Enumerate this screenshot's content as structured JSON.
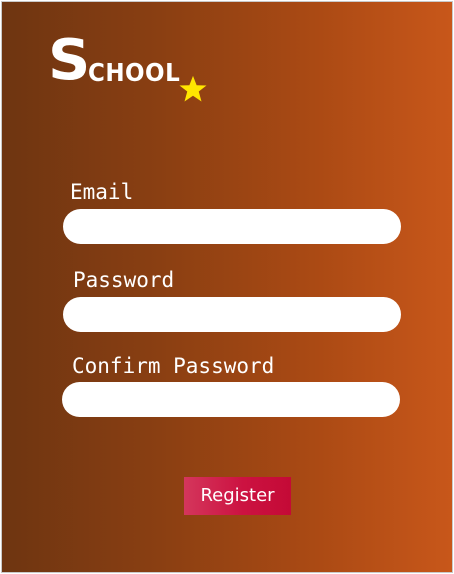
{
  "brand": {
    "initial": "S",
    "rest": "CHOOL",
    "star_color": "#ffe600"
  },
  "form": {
    "email_label": "Email",
    "email_value": "",
    "password_label": "Password",
    "password_value": "",
    "confirm_label": "Confirm Password",
    "confirm_value": "",
    "register_label": "Register"
  },
  "colors": {
    "background_gradient": [
      "#6e3511",
      "#c8571a"
    ],
    "button": "#cc1241",
    "text": "#ffffff"
  }
}
